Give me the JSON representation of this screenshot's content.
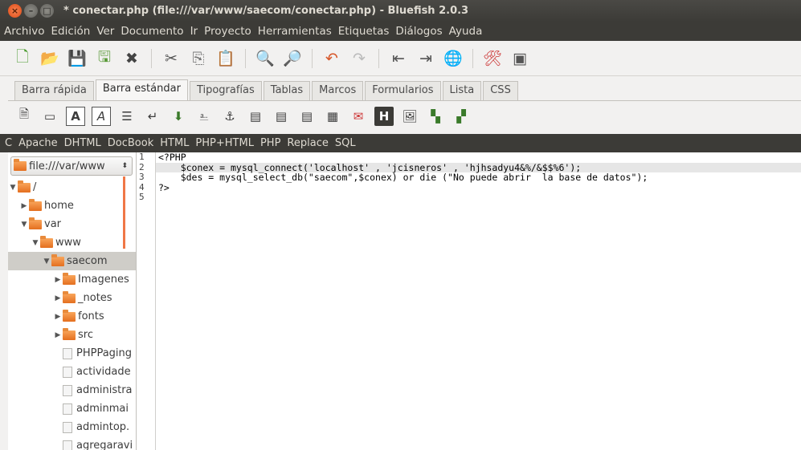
{
  "window": {
    "title": "* conectar.php (file:///var/www/saecom/conectar.php) - Bluefish 2.0.3"
  },
  "menu": [
    "Archivo",
    "Edición",
    "Ver",
    "Documento",
    "Ir",
    "Proyecto",
    "Herramientas",
    "Etiquetas",
    "Diálogos",
    "Ayuda"
  ],
  "toolbar_icons": [
    "new-file-icon",
    "open-file-icon",
    "save-icon",
    "save-as-icon",
    "close-icon",
    "cut-icon",
    "copy-icon",
    "paste-icon",
    "search-icon",
    "search-replace-icon",
    "undo-icon",
    "redo-icon",
    "unindent-icon",
    "indent-icon",
    "browser-preview-icon",
    "preferences-icon",
    "fullscreen-icon"
  ],
  "tabs": [
    "Barra rápida",
    "Barra estándar",
    "Tipografías",
    "Tablas",
    "Marcos",
    "Formularios",
    "Lista",
    "CSS"
  ],
  "active_tab": "Barra estándar",
  "html_toolbar": {
    "box_a_bold": "A",
    "box_a_italic": "A",
    "heading": "H"
  },
  "lang_menu": [
    "C",
    "Apache",
    "DHTML",
    "DocBook",
    "HTML",
    "PHP+HTML",
    "PHP",
    "Replace",
    "SQL"
  ],
  "sidebar": {
    "path": "file:///var/www",
    "tree": [
      {
        "label": "/",
        "type": "folder",
        "depth": 0,
        "expanded": true
      },
      {
        "label": "home",
        "type": "folder",
        "depth": 1,
        "expanded": false
      },
      {
        "label": "var",
        "type": "folder",
        "depth": 1,
        "expanded": true
      },
      {
        "label": "www",
        "type": "folder",
        "depth": 2,
        "expanded": true
      },
      {
        "label": "saecom",
        "type": "folder",
        "depth": 3,
        "expanded": true,
        "selected": true
      },
      {
        "label": "Imagenes",
        "type": "folder",
        "depth": 4,
        "expanded": false
      },
      {
        "label": "_notes",
        "type": "folder",
        "depth": 4,
        "expanded": false
      },
      {
        "label": "fonts",
        "type": "folder",
        "depth": 4,
        "expanded": false
      },
      {
        "label": "src",
        "type": "folder",
        "depth": 4,
        "expanded": false
      },
      {
        "label": "PHPPaging",
        "type": "file",
        "depth": 4
      },
      {
        "label": "actividade",
        "type": "file",
        "depth": 4
      },
      {
        "label": "administra",
        "type": "file",
        "depth": 4
      },
      {
        "label": "adminmai",
        "type": "file",
        "depth": 4
      },
      {
        "label": "admintop.",
        "type": "file",
        "depth": 4
      },
      {
        "label": "agregaravi",
        "type": "file",
        "depth": 4
      }
    ]
  },
  "editor": {
    "line_numbers": [
      "1",
      "2",
      "3",
      "4",
      "5"
    ],
    "current_line": 2,
    "lines": [
      "<?PHP",
      "    $conex = mysql_connect('localhost' , 'jcisneros' , 'hjhsadyu4&%/&$$%6');",
      "    $des = mysql_select_db(\"saecom\",$conex) or die (\"No puede abrir  la base de datos\");",
      "?>",
      ""
    ]
  }
}
